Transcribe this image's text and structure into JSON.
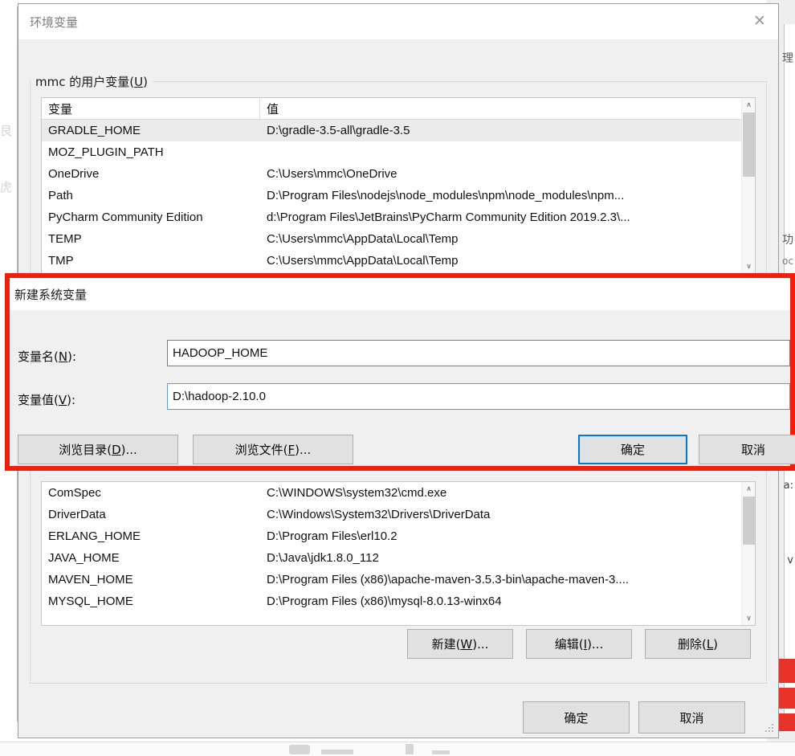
{
  "window": {
    "title": "环境变量",
    "close_icon": "close-icon",
    "close_glyph": "✕"
  },
  "user_vars": {
    "group_label_pre": "mmc 的用户变量(",
    "group_label_key": "U",
    "group_label_post": ")",
    "columns": [
      "变量",
      "值"
    ],
    "rows": [
      {
        "name": "GRADLE_HOME",
        "value": "D:\\gradle-3.5-all\\gradle-3.5",
        "selected": true
      },
      {
        "name": "MOZ_PLUGIN_PATH",
        "value": "",
        "selected": false
      },
      {
        "name": "OneDrive",
        "value": "C:\\Users\\mmc\\OneDrive",
        "selected": false
      },
      {
        "name": "Path",
        "value": "D:\\Program Files\\nodejs\\node_modules\\npm\\node_modules\\npm...",
        "selected": false
      },
      {
        "name": "PyCharm Community Edition",
        "value": "d:\\Program Files\\JetBrains\\PyCharm Community Edition 2019.2.3\\...",
        "selected": false
      },
      {
        "name": "TEMP",
        "value": "C:\\Users\\mmc\\AppData\\Local\\Temp",
        "selected": false
      },
      {
        "name": "TMP",
        "value": "C:\\Users\\mmc\\AppData\\Local\\Temp",
        "selected": false
      }
    ]
  },
  "system_vars": {
    "rows": [
      {
        "name": "ComSpec",
        "value": "C:\\WINDOWS\\system32\\cmd.exe"
      },
      {
        "name": "DriverData",
        "value": "C:\\Windows\\System32\\Drivers\\DriverData"
      },
      {
        "name": "ERLANG_HOME",
        "value": "D:\\Program Files\\erl10.2"
      },
      {
        "name": "JAVA_HOME",
        "value": "D:\\Java\\jdk1.8.0_112"
      },
      {
        "name": "MAVEN_HOME",
        "value": "D:\\Program Files (x86)\\apache-maven-3.5.3-bin\\apache-maven-3...."
      },
      {
        "name": "MYSQL_HOME",
        "value": "D:\\Program Files (x86)\\mysql-8.0.13-winx64"
      }
    ],
    "scroll_up_glyph": "∧",
    "scroll_down_glyph": "∨",
    "buttons": [
      {
        "pre": "新建(",
        "key": "W",
        "post": ")...",
        "name": "new-system-variable-button"
      },
      {
        "pre": "编辑(",
        "key": "I",
        "post": ")...",
        "name": "edit-system-variable-button"
      },
      {
        "pre": "删除(",
        "key": "L",
        "post": ")",
        "name": "delete-system-variable-button"
      }
    ]
  },
  "dialog_buttons": {
    "ok": "确定",
    "cancel": "取消"
  },
  "new_variable_dialog": {
    "title": "新建系统变量",
    "name_label_pre": "变量名(",
    "name_label_key": "N",
    "name_label_post": "):",
    "value_label_pre": "变量值(",
    "value_label_key": "V",
    "value_label_post": "):",
    "name_value": "HADOOP_HOME",
    "value_value": "D:\\hadoop-2.10.0",
    "browse_dir_pre": "浏览目录(",
    "browse_dir_key": "D",
    "browse_dir_post": ")...",
    "browse_file_pre": "浏览文件(",
    "browse_file_key": "F",
    "browse_file_post": ")...",
    "ok": "确定",
    "cancel": "取消",
    "highlight_color": "#f01e0a",
    "focus_color": "#0078d7"
  },
  "background": {
    "left_glyphs": [
      "艮",
      "虎"
    ],
    "right_glyphs": [
      "理",
      "功",
      "oc",
      "a:",
      "v"
    ]
  }
}
